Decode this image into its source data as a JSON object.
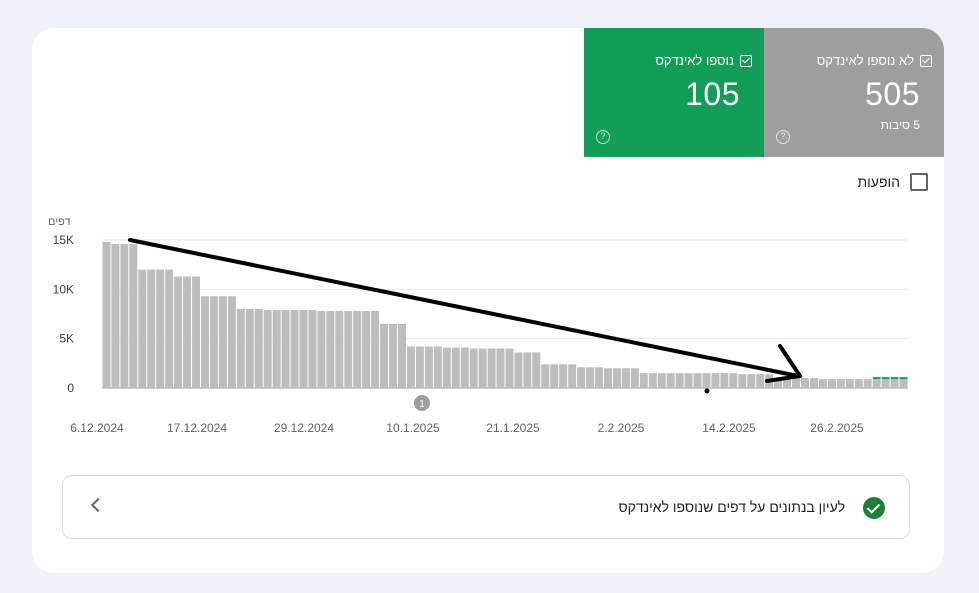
{
  "tiles": {
    "indexed": {
      "label": "נוספו לאינדקס",
      "value": "105",
      "color": "#129e57"
    },
    "not_indexed": {
      "label": "לא נוספו לאינדקס",
      "value": "505",
      "sub": "5 סיבות",
      "color": "#9e9e9e"
    }
  },
  "impressions": {
    "label": "הופעות"
  },
  "annotation_marker": "1",
  "nav_item": {
    "label": "לעיון בנתונים על דפים שנוספו לאינדקס"
  },
  "chart_data": {
    "type": "bar",
    "ylabel": "דפים",
    "ylim": [
      0,
      15000
    ],
    "y_ticks": [
      {
        "value": 0,
        "label": "0"
      },
      {
        "value": 5000,
        "label": "5K"
      },
      {
        "value": 10000,
        "label": "10K"
      },
      {
        "value": 15000,
        "label": "15K"
      }
    ],
    "x_tick_labels": [
      "6.12.2024",
      "17.12.2024",
      "29.12.2024",
      "10.1.2025",
      "21.1.2025",
      "2.2.2025",
      "14.2.2025",
      "26.2.2025"
    ],
    "categories_note": "daily bars from 4.12.2024 to 3.3.2025",
    "series": [
      {
        "values": [
          14800,
          14600,
          14600,
          14600,
          12000,
          12000,
          12000,
          12000,
          11300,
          11300,
          11300,
          9300,
          9300,
          9300,
          9300,
          8000,
          8000,
          8000,
          7900,
          7900,
          7900,
          7900,
          7900,
          7900,
          7800,
          7800,
          7800,
          7800,
          7800,
          7800,
          7800,
          6500,
          6500,
          6500,
          4200,
          4200,
          4200,
          4200,
          4100,
          4100,
          4100,
          4000,
          4000,
          4000,
          4000,
          4000,
          3600,
          3600,
          3600,
          2400,
          2400,
          2400,
          2400,
          2100,
          2100,
          2100,
          2000,
          2000,
          2000,
          2000,
          1500,
          1500,
          1500,
          1500,
          1500,
          1500,
          1500,
          1500,
          1500,
          1500,
          1500,
          1400,
          1400,
          1400,
          1400,
          1000,
          1000,
          1000,
          1000,
          1000,
          900,
          900,
          900,
          900,
          900,
          900,
          900,
          900,
          900,
          900
        ]
      },
      {
        "values": [
          0,
          0,
          0,
          0,
          0,
          0,
          0,
          0,
          0,
          0,
          0,
          0,
          0,
          0,
          0,
          0,
          0,
          0,
          0,
          0,
          0,
          0,
          0,
          0,
          0,
          0,
          0,
          0,
          0,
          0,
          0,
          0,
          0,
          0,
          0,
          0,
          0,
          0,
          0,
          0,
          0,
          0,
          0,
          0,
          0,
          0,
          0,
          0,
          0,
          0,
          0,
          0,
          0,
          0,
          0,
          0,
          0,
          0,
          0,
          0,
          0,
          0,
          0,
          0,
          0,
          0,
          0,
          0,
          0,
          0,
          0,
          0,
          0,
          0,
          0,
          0,
          0,
          0,
          0,
          0,
          0,
          0,
          0,
          0,
          0,
          0,
          105,
          105,
          105,
          105
        ]
      }
    ],
    "colors": {
      "not_indexed": "#bdbdbd",
      "indexed": "#129e57",
      "arrow": "#000000"
    },
    "grid": true
  }
}
